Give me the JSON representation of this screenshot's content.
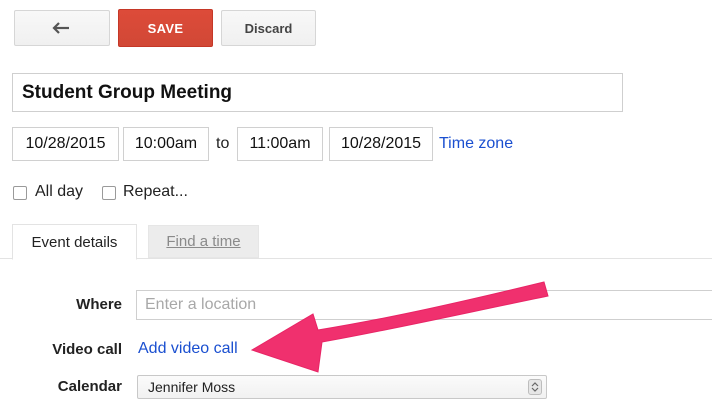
{
  "toolbar": {
    "back_icon": "back-arrow-icon",
    "save_label": "SAVE",
    "discard_label": "Discard",
    "save_color": "#d14836"
  },
  "event": {
    "title": "Student Group Meeting",
    "start_date": "10/28/2015",
    "start_time": "10:00am",
    "to_label": "to",
    "end_time": "11:00am",
    "end_date": "10/28/2015",
    "timezone_link": "Time zone"
  },
  "options": {
    "all_day_label": "All day",
    "all_day_checked": false,
    "repeat_label": "Repeat...",
    "repeat_checked": false
  },
  "tabs": [
    {
      "label": "Event details",
      "active": true
    },
    {
      "label": "Find a time",
      "active": false
    }
  ],
  "details": {
    "where_label": "Where",
    "where_placeholder": "Enter a location",
    "video_label": "Video call",
    "video_link": "Add video call",
    "calendar_label": "Calendar",
    "calendar_value": "Jennifer Moss"
  },
  "annotation": {
    "arrow_color": "#f0306e",
    "arrow_icon": "annotation-arrow"
  },
  "colors": {
    "link": "#1a4fd0"
  }
}
